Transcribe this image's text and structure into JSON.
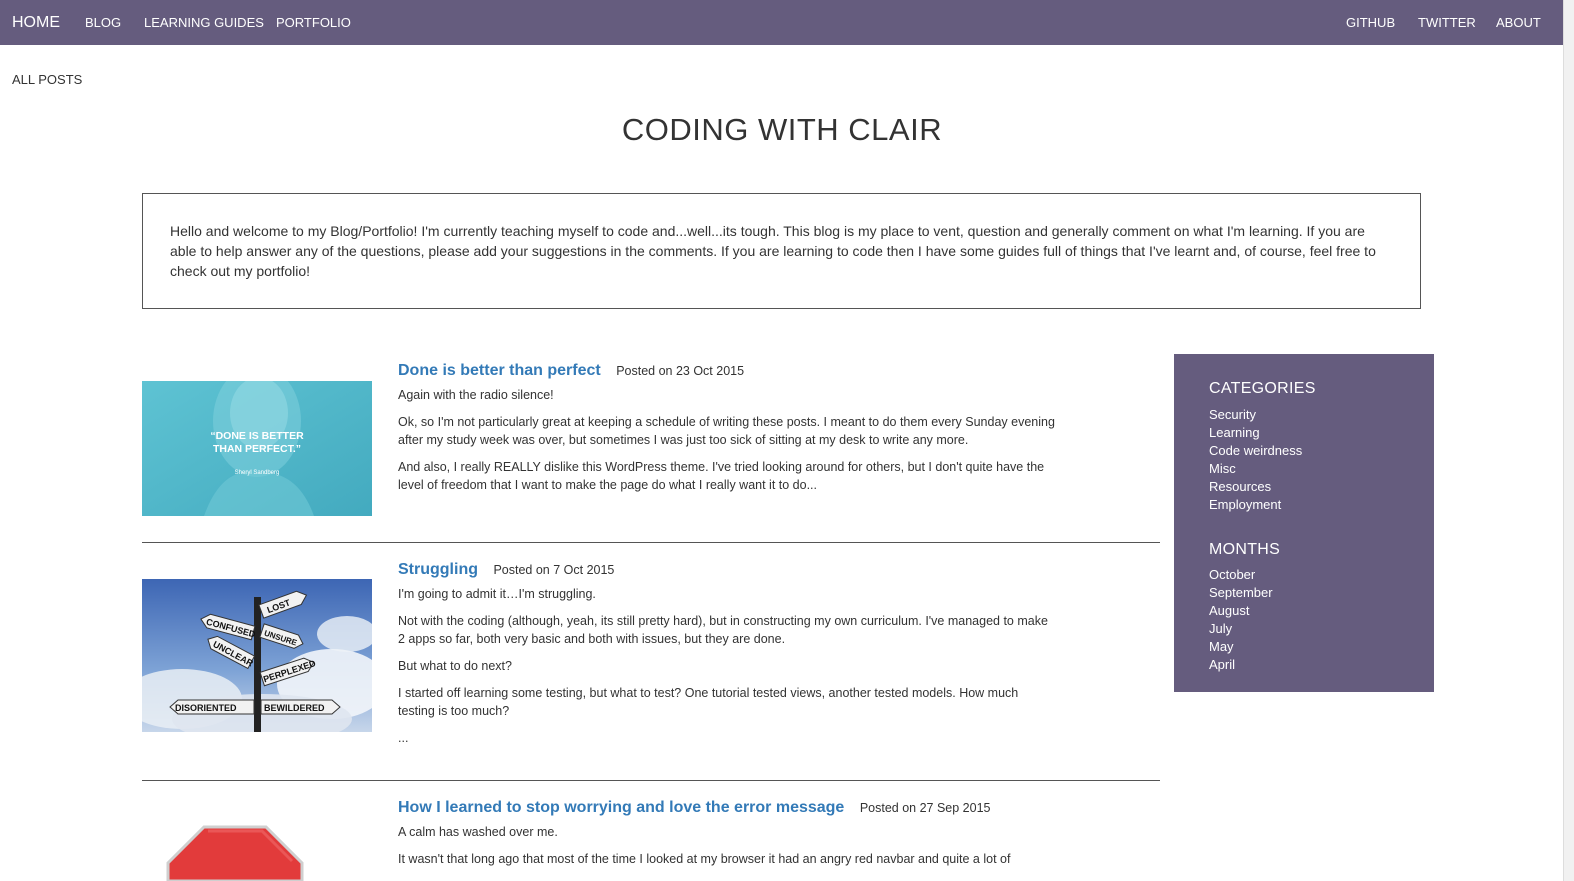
{
  "nav": {
    "home": "HOME",
    "left_links": [
      "BLOG",
      "LEARNING GUIDES",
      "PORTFOLIO"
    ],
    "right_links": [
      "GITHUB",
      "TWITTER",
      "ABOUT"
    ]
  },
  "breadcrumb": "ALL POSTS",
  "site_title": "CODING WITH CLAIR",
  "intro": "Hello and welcome to my Blog/Portfolio! I'm currently teaching myself to code and...well...its tough. This blog is my place to vent, question and generally comment on what I'm learning. If you are able to help answer any of the questions, please add your suggestions in the comments. If you are learning to code then I have some guides full of things that I've learnt and, of course, feel free to check out my portfolio!",
  "posts": [
    {
      "title": "Done is better than perfect",
      "date": "Posted on 23 Oct 2015",
      "image": {
        "quote": "\"DONE IS BETTER THAN PERFECT.\"",
        "author": "Sheryl Sandberg"
      },
      "paragraphs": [
        "Again with the radio silence!",
        "Ok, so I'm not particularly great at keeping a schedule of writing these posts. I meant to do them every Sunday evening after my study week was over, but sometimes I was just too sick of sitting at my desk to write any more.",
        "And also, I really REALLY dislike this WordPress theme. I've tried looking around for others, but I don't quite have the level of freedom that I want to make the page do what I really want it to do..."
      ]
    },
    {
      "title": "Struggling",
      "date": "Posted on 7 Oct 2015",
      "image": {
        "signs": [
          "LOST",
          "CONFUSED",
          "UNSURE",
          "UNCLEAR",
          "PERPLEXED",
          "DISORIENTED",
          "BEWILDERED"
        ]
      },
      "paragraphs": [
        "I'm going to admit it…I'm struggling.",
        "Not with the coding (although, yeah, its still pretty hard), but in constructing my own curriculum. I've managed to make 2 apps so far, both very basic and both with issues, but they are done.",
        "But what to do next?",
        "I started off learning some testing, but what to test? One tutorial tested views, another tested models. How much testing is too much?",
        "..."
      ]
    },
    {
      "title": "How I learned to stop worrying and love the error message",
      "date": "Posted on 27 Sep 2015",
      "paragraphs": [
        "A calm has washed over me.",
        "It wasn't that long ago that most of the time I looked at my browser it had an angry red navbar and quite a lot of"
      ]
    }
  ],
  "sidebar": {
    "categories_heading": "CATEGORIES",
    "categories": [
      "Security",
      "Learning",
      "Code weirdness",
      "Misc",
      "Resources",
      "Employment"
    ],
    "months_heading": "MONTHS",
    "months": [
      "October",
      "September",
      "August",
      "July",
      "May",
      "April"
    ]
  },
  "colors": {
    "navbar": "#655c7e",
    "link": "#337ab7",
    "sidebar": "#655c7e"
  }
}
